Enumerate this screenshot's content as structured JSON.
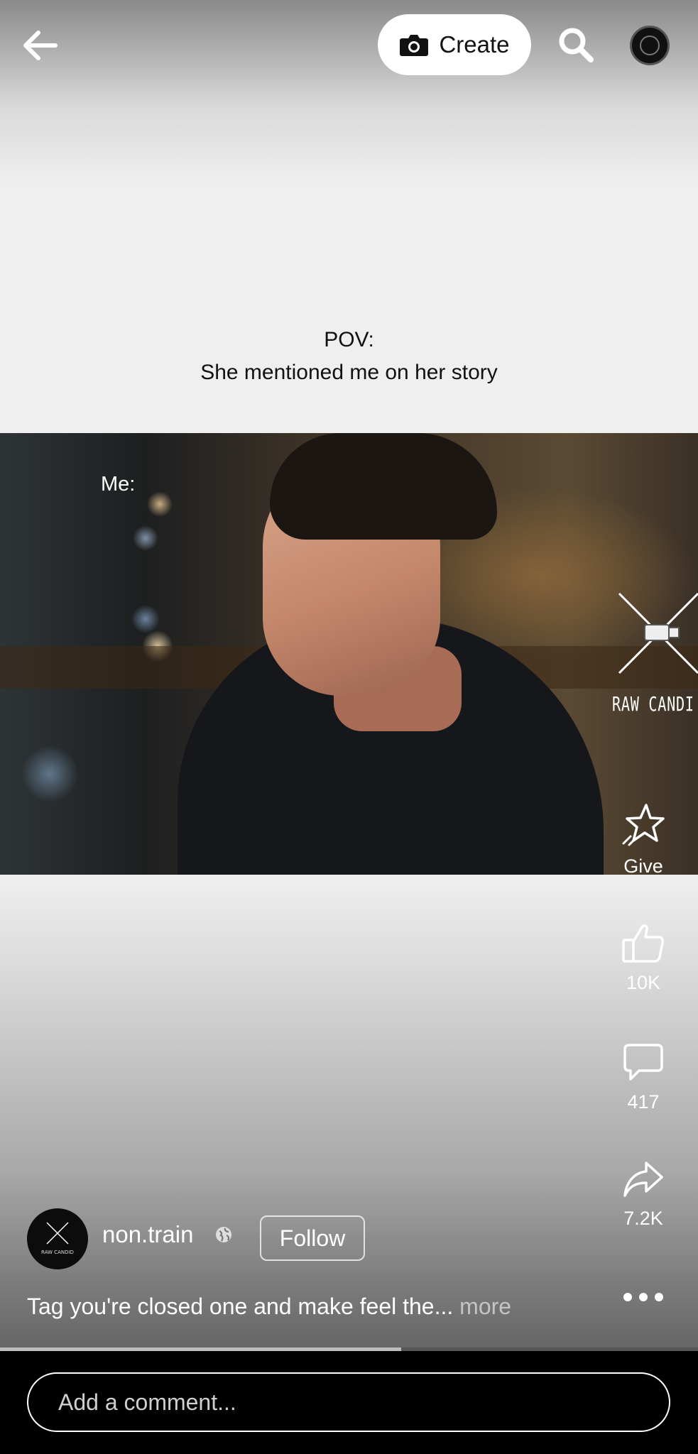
{
  "topbar": {
    "create_label": "Create",
    "back_icon": "arrow-left-icon",
    "camera_icon": "camera-icon",
    "search_icon": "search-icon"
  },
  "post": {
    "caption_line1": "POV:",
    "caption_line2": "She mentioned me on her story",
    "video_overlay_text": "Me:",
    "watermark_text": "RAW CANDI",
    "progress": 0.575
  },
  "actions": {
    "give_label": "Give",
    "likes": "10K",
    "comments": "417",
    "shares": "7.2K"
  },
  "author": {
    "name": "non.train",
    "follow_label": "Follow",
    "avatar_text": "RAW CANDID",
    "privacy_icon": "globe-icon"
  },
  "description": {
    "text": "Tag you're closed one and make feel the... ",
    "more_label": "more"
  },
  "comment": {
    "placeholder": "Add a comment..."
  },
  "colors": {
    "text_on_dark": "#ffffff",
    "caption_text": "#111111",
    "comment_bar_bg": "#000000"
  }
}
